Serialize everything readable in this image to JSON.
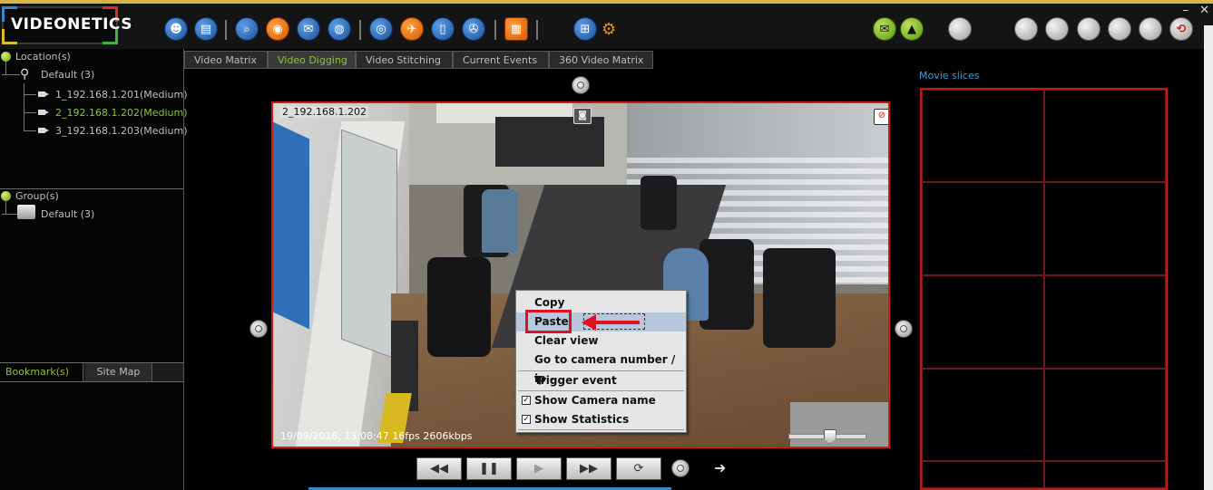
{
  "app": {
    "brand": "VIDEONETICS",
    "window_controls": {
      "minimize": "–",
      "close": "✕"
    }
  },
  "toolbar": {
    "icons": [
      "user-icon",
      "report-icon",
      "search-camera-icon",
      "snapshot-icon",
      "mail-icon",
      "globe-icon",
      "zoom-icon",
      "run-icon",
      "mobile-icon",
      "film-icon",
      "layout-icon",
      "grid-icon",
      "settings-gear-icon",
      "message-icon",
      "bell-icon",
      "power-icon"
    ]
  },
  "location_panel": {
    "header": "Location(s)",
    "group": "Default (3)",
    "cameras": [
      {
        "label": "1_192.168.1.201(Medium)",
        "selected": false
      },
      {
        "label": "2_192.168.1.202(Medium)",
        "selected": true
      },
      {
        "label": "3_192.168.1.203(Medium)",
        "selected": false
      }
    ]
  },
  "group_panel": {
    "header": "Group(s)",
    "group": "Default (3)"
  },
  "bottom_tabs": {
    "bookmarks": "Bookmark(s)",
    "site_map": "Site Map"
  },
  "main_tabs": [
    {
      "label": "Video Matrix",
      "active": false
    },
    {
      "label": "Video Digging",
      "active": true
    },
    {
      "label": "Video Stitching",
      "active": false
    },
    {
      "label": "Current Events",
      "active": false
    },
    {
      "label": "360 Video Matrix",
      "active": false
    }
  ],
  "video": {
    "camera_name": "2_192.168.1.202",
    "overlay": "19/09/2016, 13:08:47  16fps 2606kbps",
    "volume_level": 0.52
  },
  "context_menu": {
    "items": {
      "copy": "Copy",
      "paste": "Paste",
      "clear_view": "Clear view",
      "goto_camera": "Go to camera number / ip -",
      "trigger_event": "Trigger event",
      "show_camera_name": "Show Camera name",
      "show_statistics": "Show Statistics"
    },
    "checked": {
      "show_camera_name": true,
      "show_statistics": true
    },
    "highlighted": "Paste"
  },
  "playback": {
    "rewind": "◀◀",
    "pause": "❚❚",
    "play": "▶",
    "forward": "▶▶",
    "loop": "⟳",
    "next": "➜"
  },
  "movie_slices": {
    "title": "Movie slices"
  },
  "colors": {
    "accent_green": "#8fc23a",
    "highlight_red": "#d01a1a",
    "slices_title": "#3a9ad9"
  }
}
